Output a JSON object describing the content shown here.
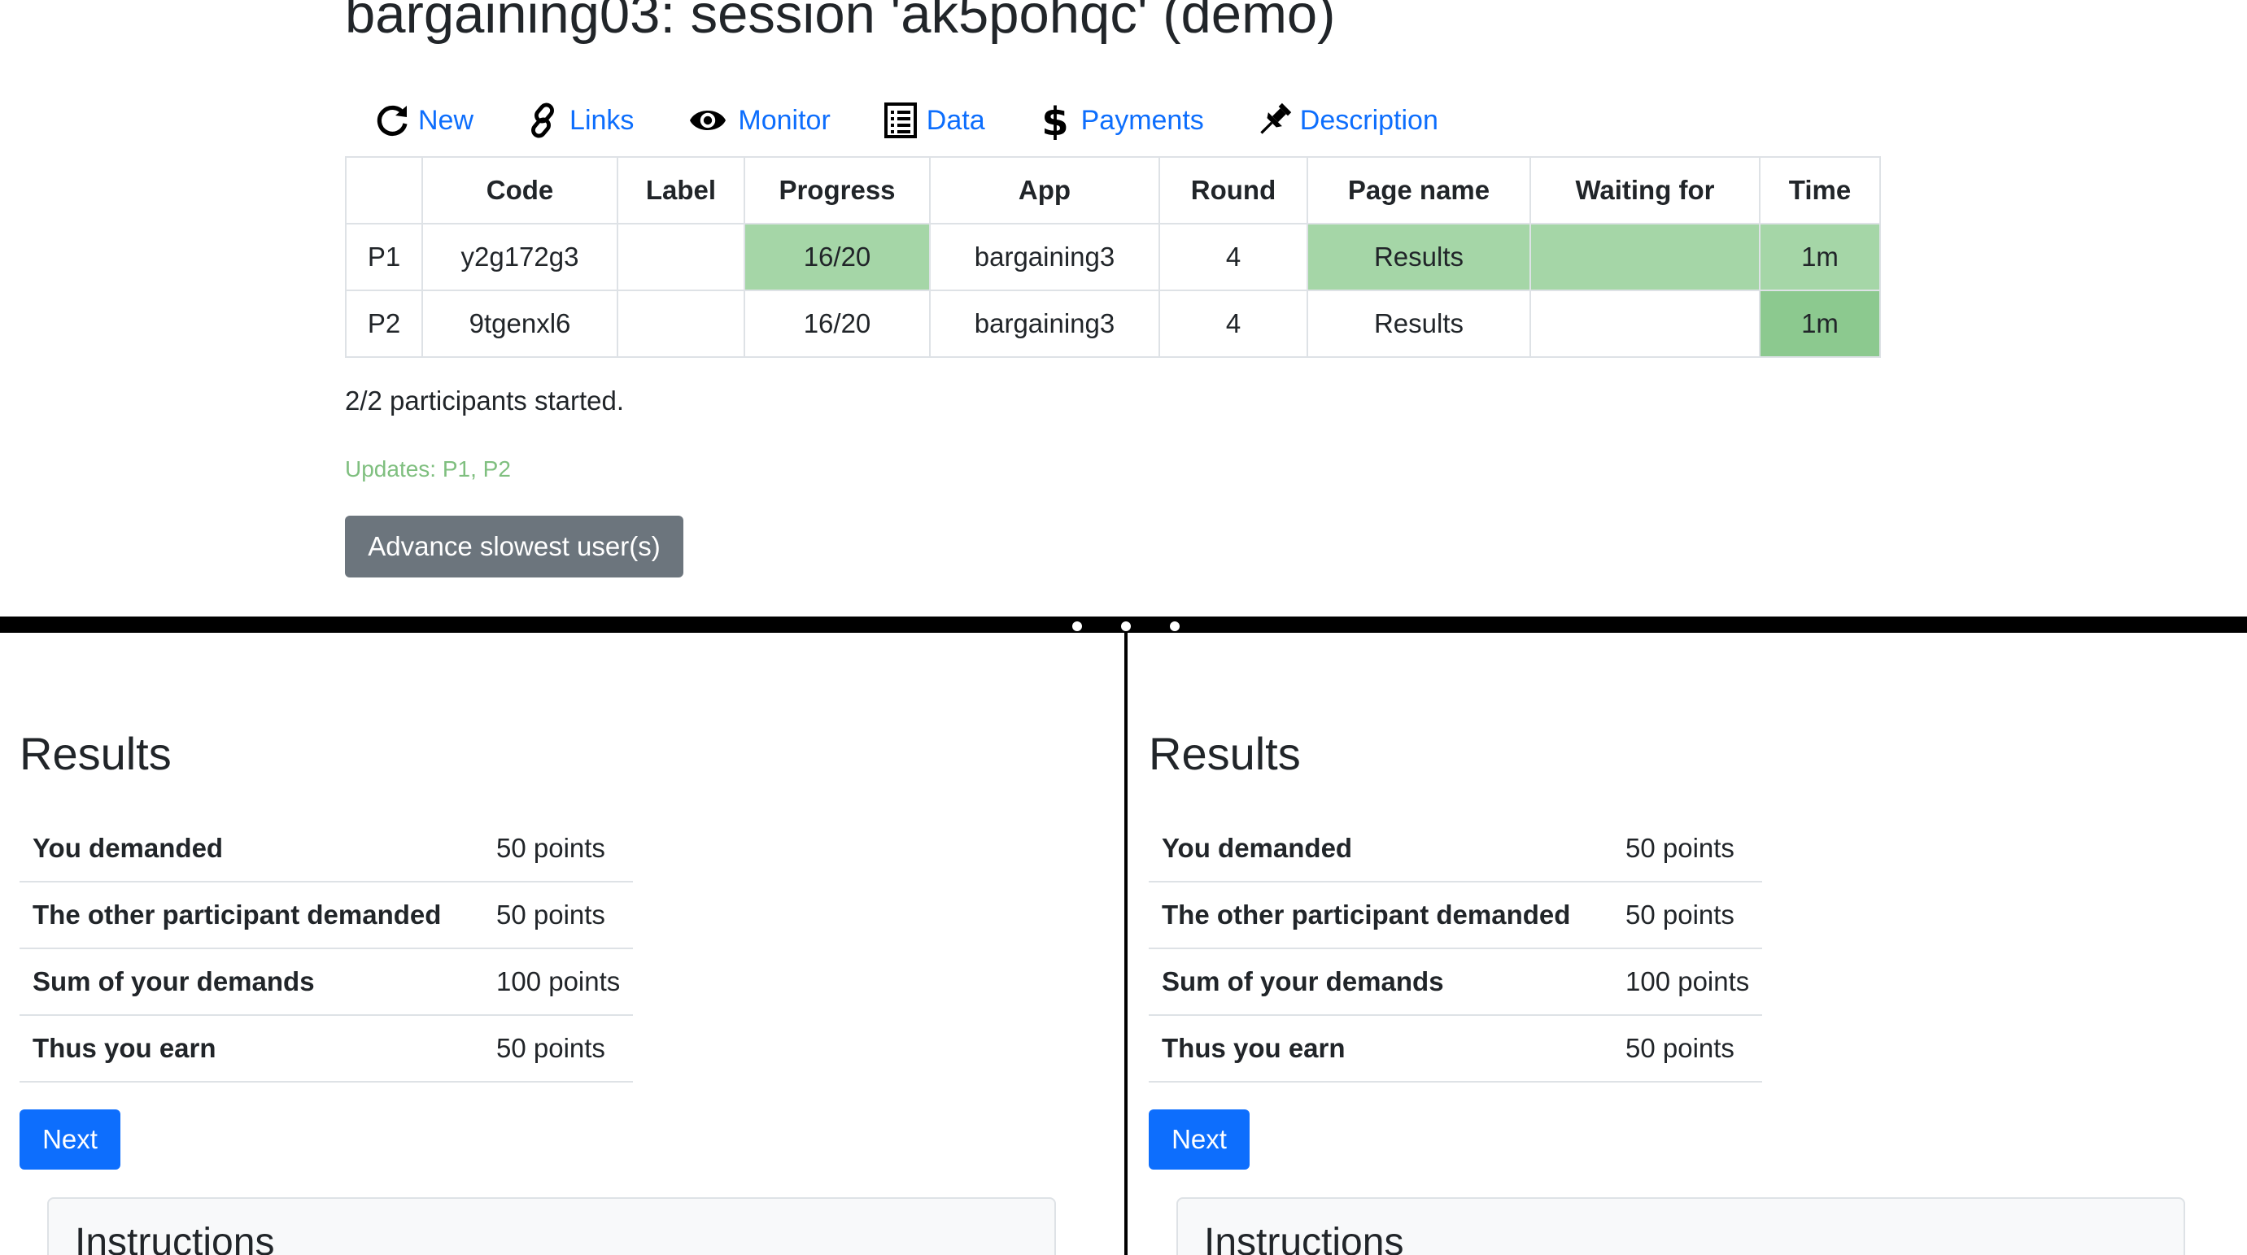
{
  "admin": {
    "title": "bargaining03: session 'ak5pohqc' (demo)",
    "nav": [
      {
        "label": "New",
        "icon": "refresh-icon"
      },
      {
        "label": "Links",
        "icon": "link-icon"
      },
      {
        "label": "Monitor",
        "icon": "eye-icon"
      },
      {
        "label": "Data",
        "icon": "list-icon"
      },
      {
        "label": "Payments",
        "icon": "dollar-icon"
      },
      {
        "label": "Description",
        "icon": "pin-icon"
      }
    ],
    "table": {
      "headers": [
        "",
        "Code",
        "Label",
        "Progress",
        "App",
        "Round",
        "Page name",
        "Waiting for",
        "Time"
      ],
      "rows": [
        {
          "id": "P1",
          "code": "y2g172g3",
          "label": "",
          "progress": "16/20",
          "app": "bargaining3",
          "round": "4",
          "page": "Results",
          "waiting": "",
          "time": "1m"
        },
        {
          "id": "P2",
          "code": "9tgenxl6",
          "label": "",
          "progress": "16/20",
          "app": "bargaining3",
          "round": "4",
          "page": "Results",
          "waiting": "",
          "time": "1m"
        }
      ]
    },
    "started_text": "2/2 participants started.",
    "updates_text": "Updates: P1, P2",
    "advance_label": "Advance slowest user(s)",
    "colors": {
      "link": "#0d6efd",
      "highlight": "#a5d6a7",
      "highlight_dark": "#8cc98f",
      "updates": "#7fbf7f"
    }
  },
  "panes": [
    {
      "heading": "Results",
      "rows": [
        {
          "label": "You demanded",
          "value": "50 points"
        },
        {
          "label": "The other participant demanded",
          "value": "50 points"
        },
        {
          "label": "Sum of your demands",
          "value": "100 points"
        },
        {
          "label": "Thus you earn",
          "value": "50 points"
        }
      ],
      "next_label": "Next",
      "instructions_title": "Instructions"
    },
    {
      "heading": "Results",
      "rows": [
        {
          "label": "You demanded",
          "value": "50 points"
        },
        {
          "label": "The other participant demanded",
          "value": "50 points"
        },
        {
          "label": "Sum of your demands",
          "value": "100 points"
        },
        {
          "label": "Thus you earn",
          "value": "50 points"
        }
      ],
      "next_label": "Next",
      "instructions_title": "Instructions"
    }
  ]
}
